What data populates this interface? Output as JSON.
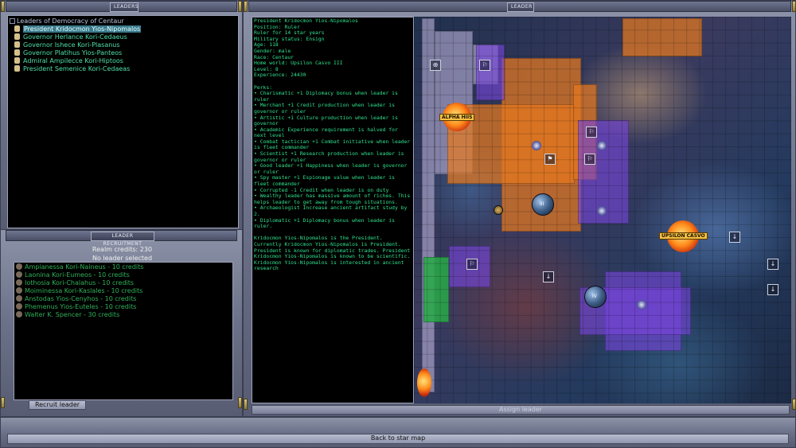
{
  "panels": {
    "leaders_title": "LEADERS",
    "leader_title": "LEADER",
    "recruitment_title": "LEADER RECRUITMENT"
  },
  "leaders": {
    "root_label": "Leaders of Democracy of Centaur",
    "items": [
      {
        "label": "President Kridocmon Yios-Nipomalos"
      },
      {
        "label": "Governor Herlance Kori-Cedaeus"
      },
      {
        "label": "Governor Ishece Kori-Plasanus"
      },
      {
        "label": "Governor Platihus Yios-Panteos"
      },
      {
        "label": "Admiral Ampilecce Kori-Hiptoos"
      },
      {
        "label": "President Semenice Kori-Cedaeas"
      }
    ]
  },
  "recruitment": {
    "realm_credits": "Realm credits: 230",
    "selection": "No leader selected",
    "candidates": [
      "Ampianessa Kori-Naineus - 10 credits",
      "Laonina Kori-Eumeos - 10 credits",
      "Iothosia Kori-Chalahus - 10 credits",
      "Moiminessa Kori-Kaslales - 10 credits",
      "Anstodas Yios-Cenyhos - 10 credits",
      "Phemenus Yios-Euteles - 10 credits",
      "Walter K. Spencer - 30 credits"
    ],
    "recruit_button": "Recruit leader"
  },
  "leader_info": {
    "text": "President Kridocmon Yios-Nipomalos\nPosition: Ruler\nRuler for 14 star years\nMilitary status: Ensign\nAge: 118\nGender: male\nRace: Centaur\nHome world: Upsilon Casvo III\nLevel: 8\nExperience: 24430\n\nPerks:\n• Charismatic +1 Diplomacy bonus when leader is ruler\n• Merchant +1 Credit production when leader is governor or ruler\n• Artistic +1 Culture production when leader is governor\n• Academic Experience requirement is halved for next level\n• Combat tactician +1 Combat initiative when leader is fleet commander\n• Scientist +1 Research production when leader is governor or ruler\n• Good leader +1 Happiness when leader is governor or ruler\n• Spy master +1 Espionage value when leader is fleet commander\n• Corrupted -1 Credit when leader is on duty\n• Wealthy leader has massive amount of riches. This helps leader to get away from tough situations.\n• Archaeologist Increase ancient artifact study by 2.\n• Diplomatic +1 Diplomacy bonus when leader is ruler.\n\nKridocmon Yios-Nipomalos is the President. Currently Kridocmon Yios-Nipomalos is President. President is known for diplomatic trades. President Kridocmon Yios-Nipomalos is known to be scientific. Kridocmon Yios-Nipomalos is interested in ancient research"
  },
  "map": {
    "stars": [
      "ALPHA HIIS",
      "UPSILON CASVO"
    ],
    "planet_labels": [
      "III",
      "IV"
    ]
  },
  "buttons": {
    "assign_leader": "Assign leader",
    "back_to_star_map": "Back to star map"
  }
}
